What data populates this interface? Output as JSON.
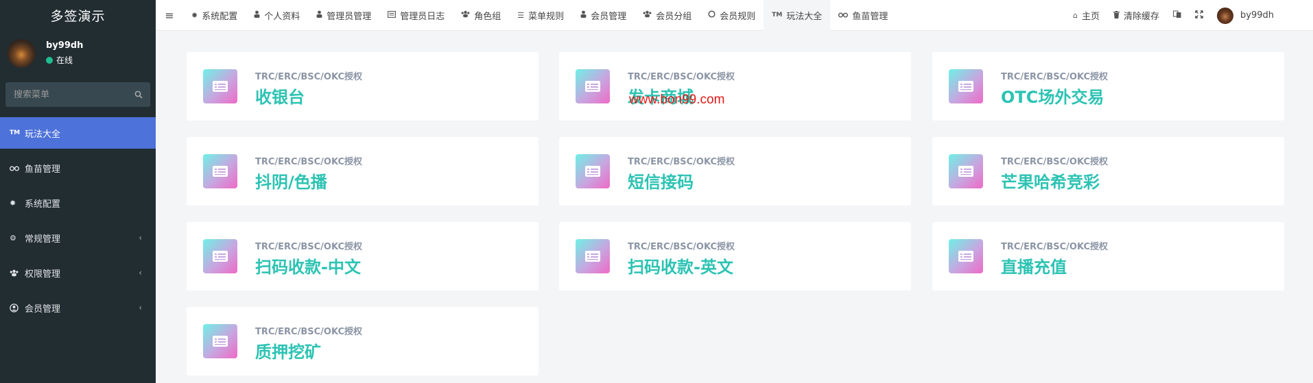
{
  "sidebar": {
    "brand": "多签演示",
    "user": {
      "name": "by99dh",
      "status": "在线"
    },
    "search": {
      "placeholder": "搜索菜单"
    },
    "items": [
      {
        "label": "玩法大全",
        "icon": "tm-icon",
        "active": true
      },
      {
        "label": "鱼苗管理",
        "icon": "binoculars-icon"
      },
      {
        "label": "系统配置",
        "icon": "gear-icon"
      },
      {
        "label": "常规管理",
        "icon": "cogs-icon"
      },
      {
        "label": "权限管理",
        "icon": "group-icon"
      },
      {
        "label": "会员管理",
        "icon": "user-circle-icon"
      }
    ]
  },
  "topnav": {
    "tabs": [
      {
        "label": "系统配置",
        "icon": "gear-icon"
      },
      {
        "label": "个人资料",
        "icon": "user-icon"
      },
      {
        "label": "管理员管理",
        "icon": "user-icon"
      },
      {
        "label": "管理员日志",
        "icon": "list-alt-icon"
      },
      {
        "label": "角色组",
        "icon": "group-icon"
      },
      {
        "label": "菜单规则",
        "icon": "bars-icon"
      },
      {
        "label": "会员管理",
        "icon": "user-icon"
      },
      {
        "label": "会员分组",
        "icon": "users-icon"
      },
      {
        "label": "会员规则",
        "icon": "circle-o-icon"
      },
      {
        "label": "玩法大全",
        "icon": "tm-icon",
        "active": true
      },
      {
        "label": "鱼苗管理",
        "icon": "binoculars-icon"
      }
    ],
    "right": {
      "home": "主页",
      "clear_cache": "清除缓存",
      "username": "by99dh"
    }
  },
  "cards": [
    {
      "subtitle": "TRC/ERC/BSC/OKC授权",
      "title": "收银台"
    },
    {
      "subtitle": "TRC/ERC/BSC/OKC授权",
      "title": "发卡商城"
    },
    {
      "subtitle": "TRC/ERC/BSC/OKC授权",
      "title": "OTC场外交易"
    },
    {
      "subtitle": "TRC/ERC/BSC/OKC授权",
      "title": "抖阴/色播"
    },
    {
      "subtitle": "TRC/ERC/BSC/OKC授权",
      "title": "短信接码"
    },
    {
      "subtitle": "TRC/ERC/BSC/OKC授权",
      "title": "芒果哈希竞彩"
    },
    {
      "subtitle": "TRC/ERC/BSC/OKC授权",
      "title": "扫码收款-中文"
    },
    {
      "subtitle": "TRC/ERC/BSC/OKC授权",
      "title": "扫码收款-英文"
    },
    {
      "subtitle": "TRC/ERC/BSC/OKC授权",
      "title": "直播充值"
    },
    {
      "subtitle": "TRC/ERC/BSC/OKC授权",
      "title": "质押挖矿"
    }
  ],
  "watermark": "www.bon99.com",
  "colors": {
    "sidebar_bg": "#222d32",
    "active_item": "#4d72d9",
    "card_title": "#2cc3b3",
    "status_online": "#1fbf8f",
    "watermark": "#e31818"
  }
}
